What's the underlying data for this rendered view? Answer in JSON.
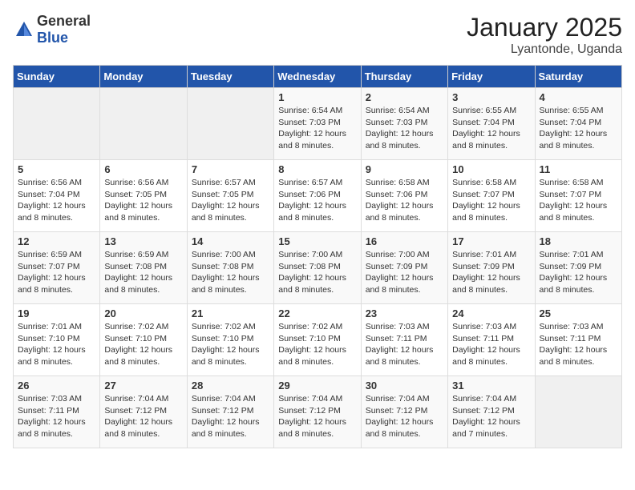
{
  "header": {
    "logo_general": "General",
    "logo_blue": "Blue",
    "month_title": "January 2025",
    "location": "Lyantonde, Uganda"
  },
  "days_of_week": [
    "Sunday",
    "Monday",
    "Tuesday",
    "Wednesday",
    "Thursday",
    "Friday",
    "Saturday"
  ],
  "weeks": [
    [
      {
        "day": "",
        "info": ""
      },
      {
        "day": "",
        "info": ""
      },
      {
        "day": "",
        "info": ""
      },
      {
        "day": "1",
        "info": "Sunrise: 6:54 AM\nSunset: 7:03 PM\nDaylight: 12 hours\nand 8 minutes."
      },
      {
        "day": "2",
        "info": "Sunrise: 6:54 AM\nSunset: 7:03 PM\nDaylight: 12 hours\nand 8 minutes."
      },
      {
        "day": "3",
        "info": "Sunrise: 6:55 AM\nSunset: 7:04 PM\nDaylight: 12 hours\nand 8 minutes."
      },
      {
        "day": "4",
        "info": "Sunrise: 6:55 AM\nSunset: 7:04 PM\nDaylight: 12 hours\nand 8 minutes."
      }
    ],
    [
      {
        "day": "5",
        "info": "Sunrise: 6:56 AM\nSunset: 7:04 PM\nDaylight: 12 hours\nand 8 minutes."
      },
      {
        "day": "6",
        "info": "Sunrise: 6:56 AM\nSunset: 7:05 PM\nDaylight: 12 hours\nand 8 minutes."
      },
      {
        "day": "7",
        "info": "Sunrise: 6:57 AM\nSunset: 7:05 PM\nDaylight: 12 hours\nand 8 minutes."
      },
      {
        "day": "8",
        "info": "Sunrise: 6:57 AM\nSunset: 7:06 PM\nDaylight: 12 hours\nand 8 minutes."
      },
      {
        "day": "9",
        "info": "Sunrise: 6:58 AM\nSunset: 7:06 PM\nDaylight: 12 hours\nand 8 minutes."
      },
      {
        "day": "10",
        "info": "Sunrise: 6:58 AM\nSunset: 7:07 PM\nDaylight: 12 hours\nand 8 minutes."
      },
      {
        "day": "11",
        "info": "Sunrise: 6:58 AM\nSunset: 7:07 PM\nDaylight: 12 hours\nand 8 minutes."
      }
    ],
    [
      {
        "day": "12",
        "info": "Sunrise: 6:59 AM\nSunset: 7:07 PM\nDaylight: 12 hours\nand 8 minutes."
      },
      {
        "day": "13",
        "info": "Sunrise: 6:59 AM\nSunset: 7:08 PM\nDaylight: 12 hours\nand 8 minutes."
      },
      {
        "day": "14",
        "info": "Sunrise: 7:00 AM\nSunset: 7:08 PM\nDaylight: 12 hours\nand 8 minutes."
      },
      {
        "day": "15",
        "info": "Sunrise: 7:00 AM\nSunset: 7:08 PM\nDaylight: 12 hours\nand 8 minutes."
      },
      {
        "day": "16",
        "info": "Sunrise: 7:00 AM\nSunset: 7:09 PM\nDaylight: 12 hours\nand 8 minutes."
      },
      {
        "day": "17",
        "info": "Sunrise: 7:01 AM\nSunset: 7:09 PM\nDaylight: 12 hours\nand 8 minutes."
      },
      {
        "day": "18",
        "info": "Sunrise: 7:01 AM\nSunset: 7:09 PM\nDaylight: 12 hours\nand 8 minutes."
      }
    ],
    [
      {
        "day": "19",
        "info": "Sunrise: 7:01 AM\nSunset: 7:10 PM\nDaylight: 12 hours\nand 8 minutes."
      },
      {
        "day": "20",
        "info": "Sunrise: 7:02 AM\nSunset: 7:10 PM\nDaylight: 12 hours\nand 8 minutes."
      },
      {
        "day": "21",
        "info": "Sunrise: 7:02 AM\nSunset: 7:10 PM\nDaylight: 12 hours\nand 8 minutes."
      },
      {
        "day": "22",
        "info": "Sunrise: 7:02 AM\nSunset: 7:10 PM\nDaylight: 12 hours\nand 8 minutes."
      },
      {
        "day": "23",
        "info": "Sunrise: 7:03 AM\nSunset: 7:11 PM\nDaylight: 12 hours\nand 8 minutes."
      },
      {
        "day": "24",
        "info": "Sunrise: 7:03 AM\nSunset: 7:11 PM\nDaylight: 12 hours\nand 8 minutes."
      },
      {
        "day": "25",
        "info": "Sunrise: 7:03 AM\nSunset: 7:11 PM\nDaylight: 12 hours\nand 8 minutes."
      }
    ],
    [
      {
        "day": "26",
        "info": "Sunrise: 7:03 AM\nSunset: 7:11 PM\nDaylight: 12 hours\nand 8 minutes."
      },
      {
        "day": "27",
        "info": "Sunrise: 7:04 AM\nSunset: 7:12 PM\nDaylight: 12 hours\nand 8 minutes."
      },
      {
        "day": "28",
        "info": "Sunrise: 7:04 AM\nSunset: 7:12 PM\nDaylight: 12 hours\nand 8 minutes."
      },
      {
        "day": "29",
        "info": "Sunrise: 7:04 AM\nSunset: 7:12 PM\nDaylight: 12 hours\nand 8 minutes."
      },
      {
        "day": "30",
        "info": "Sunrise: 7:04 AM\nSunset: 7:12 PM\nDaylight: 12 hours\nand 8 minutes."
      },
      {
        "day": "31",
        "info": "Sunrise: 7:04 AM\nSunset: 7:12 PM\nDaylight: 12 hours\nand 7 minutes."
      },
      {
        "day": "",
        "info": ""
      }
    ]
  ]
}
